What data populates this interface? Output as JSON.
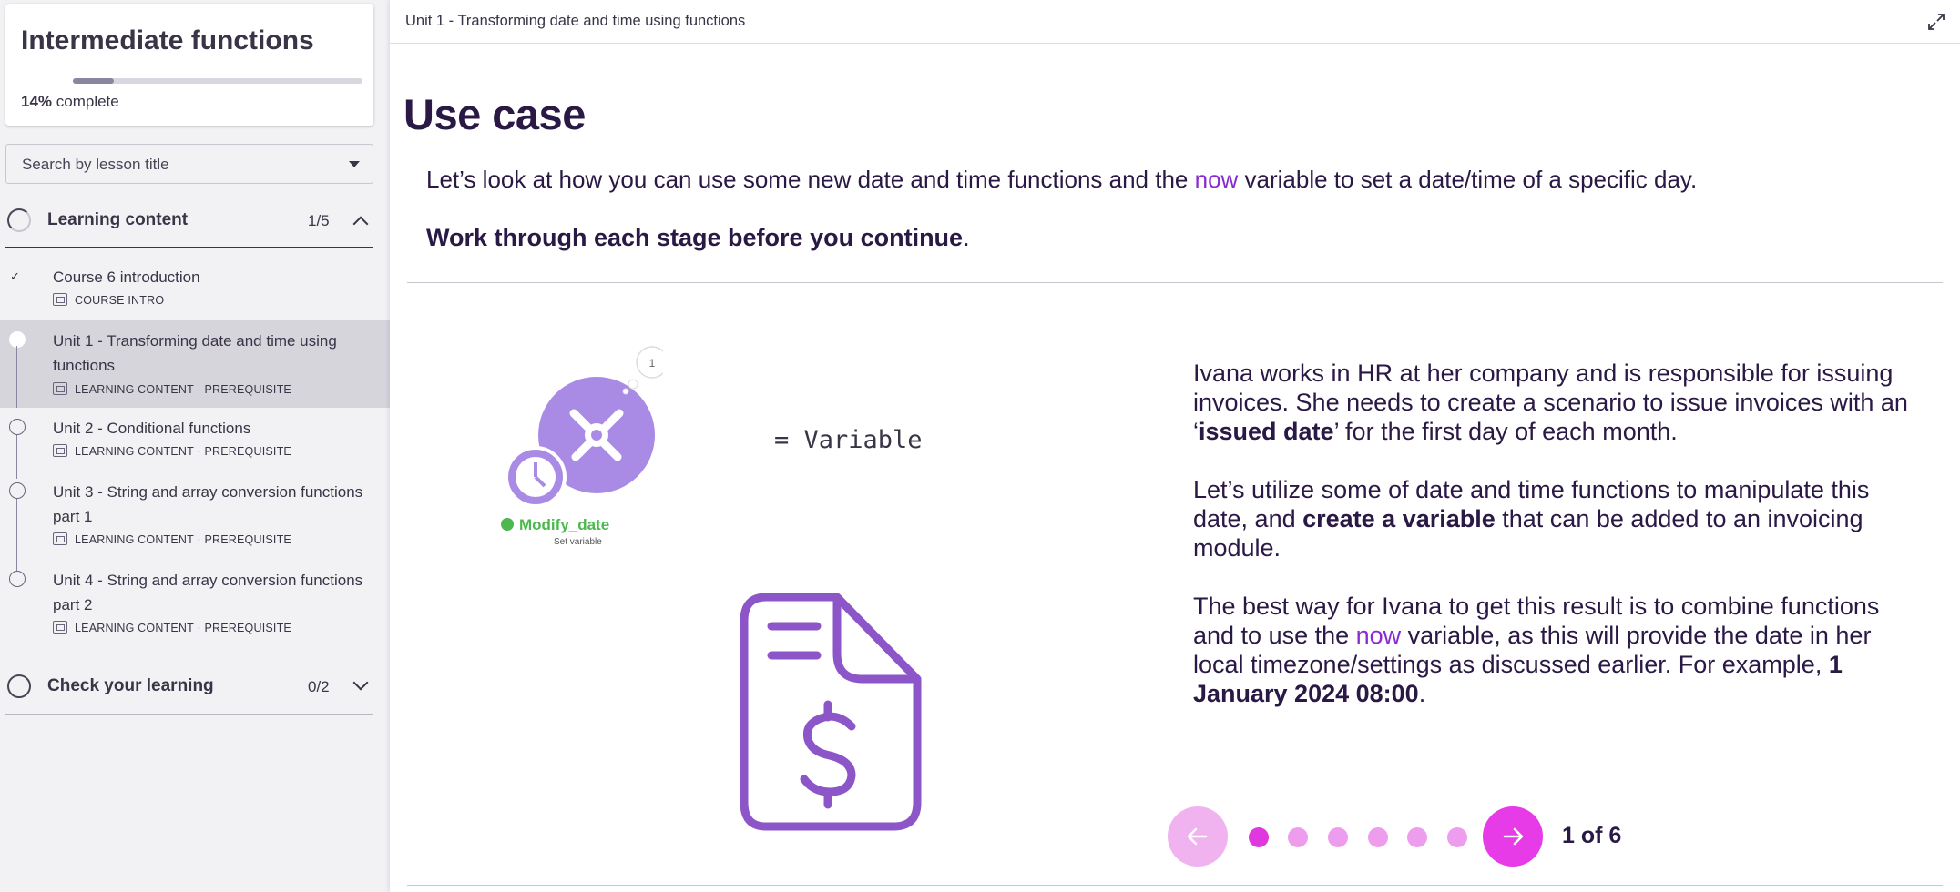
{
  "course": {
    "title": "Intermediate functions",
    "progress_percent": 14,
    "progress_pct_label": "14%",
    "progress_suffix": " complete"
  },
  "search": {
    "placeholder": "Search by lesson title"
  },
  "sections": [
    {
      "label": "Learning content",
      "count": "1/5",
      "expanded": true
    },
    {
      "label": "Check your learning",
      "count": "0/2",
      "expanded": false
    }
  ],
  "lessons": [
    {
      "title": "Course 6 introduction",
      "meta": "COURSE INTRO",
      "status": "completed"
    },
    {
      "title": "Unit 1 - Transforming date and time using functions",
      "meta": "LEARNING CONTENT · PREREQUISITE",
      "status": "active"
    },
    {
      "title": "Unit 2 - Conditional functions",
      "meta": "LEARNING CONTENT · PREREQUISITE",
      "status": "not-started"
    },
    {
      "title": "Unit 3 - String and array conversion functions part 1",
      "meta": "LEARNING CONTENT · PREREQUISITE",
      "status": "not-started"
    },
    {
      "title": "Unit 4 - String and array conversion functions part 2",
      "meta": "LEARNING CONTENT · PREREQUISITE",
      "status": "not-started"
    }
  ],
  "topbar": {
    "breadcrumb": "Unit 1 - Transforming date and time using functions",
    "expand_icon": "expand-icon"
  },
  "content": {
    "heading": "Use case",
    "intro_before": "Let’s look at how you can use some new date and time functions and the ",
    "intro_accent": "now",
    "intro_after": " variable to set a date/time of a specific day.",
    "instruction_bold": "Work through each stage before you continue",
    "instruction_tail": ".",
    "module": {
      "name": "Modify_date",
      "subtitle": "Set variable",
      "badge": "1"
    },
    "variable_label": "= Variable",
    "p1_a": "Ivana works in HR at her company and is responsible for issuing invoices. She needs to create a scenario to issue invoices with an ‘",
    "p1_b": "issued date",
    "p1_c": "’ for the first day of each month.",
    "p2_a": "Let’s utilize some of date and time functions to manipulate this date, and ",
    "p2_b": "create a variable",
    "p2_c": " that can be added to an invoicing module.",
    "p3_a": "The best way for Ivana to get this result is to combine functions and to use the ",
    "p3_accent": "now",
    "p3_b": " variable, as this will provide the date in her local timezone/settings as discussed earlier. For example, ",
    "p3_bold": "1 January 2024 08:00",
    "p3_c": "."
  },
  "pager": {
    "current": 1,
    "total": 6,
    "label": "1 of 6"
  },
  "colors": {
    "accent_text": "#8a2bd2",
    "pager_active": "#df38df",
    "pager_inactive": "#ee9cee",
    "module_purple": "#a98be6"
  }
}
